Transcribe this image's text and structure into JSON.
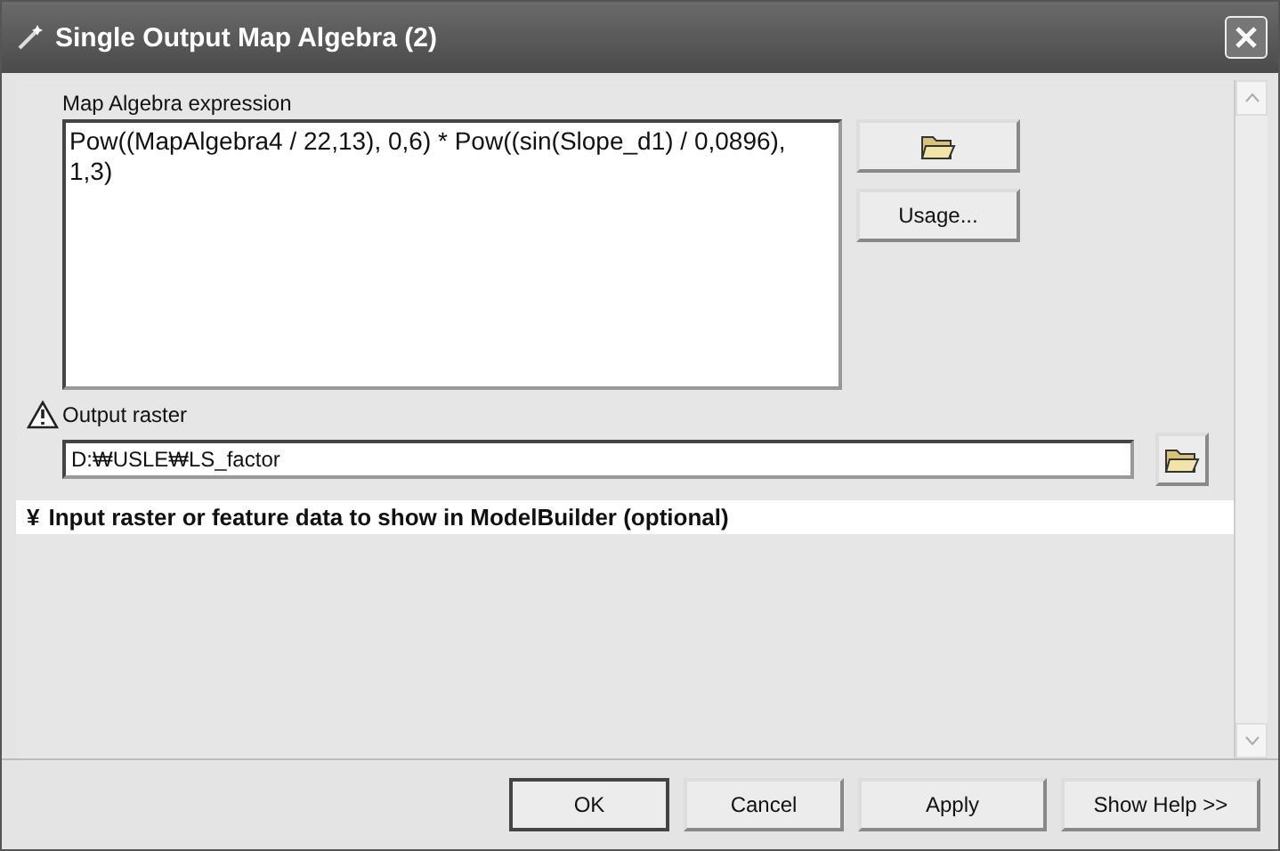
{
  "window": {
    "title": "Single Output Map Algebra (2)"
  },
  "expression": {
    "label": "Map Algebra expression",
    "value": "Pow((MapAlgebra4 / 22,13), 0,6) * Pow((sin(Slope_d1) / 0,0896), 1,3)",
    "usage_button": "Usage..."
  },
  "output": {
    "label": "Output raster",
    "warning": true,
    "value": "D:₩USLE₩LS_factor"
  },
  "section": {
    "icon": "¥",
    "label": "Input raster or feature data to show in ModelBuilder (optional)",
    "expanded": false
  },
  "buttons": [
    {
      "label": "OK",
      "default": true
    },
    {
      "label": "Cancel",
      "default": false
    },
    {
      "label": "Apply",
      "default": false
    },
    {
      "label": "Show Help >>",
      "default": false
    }
  ]
}
